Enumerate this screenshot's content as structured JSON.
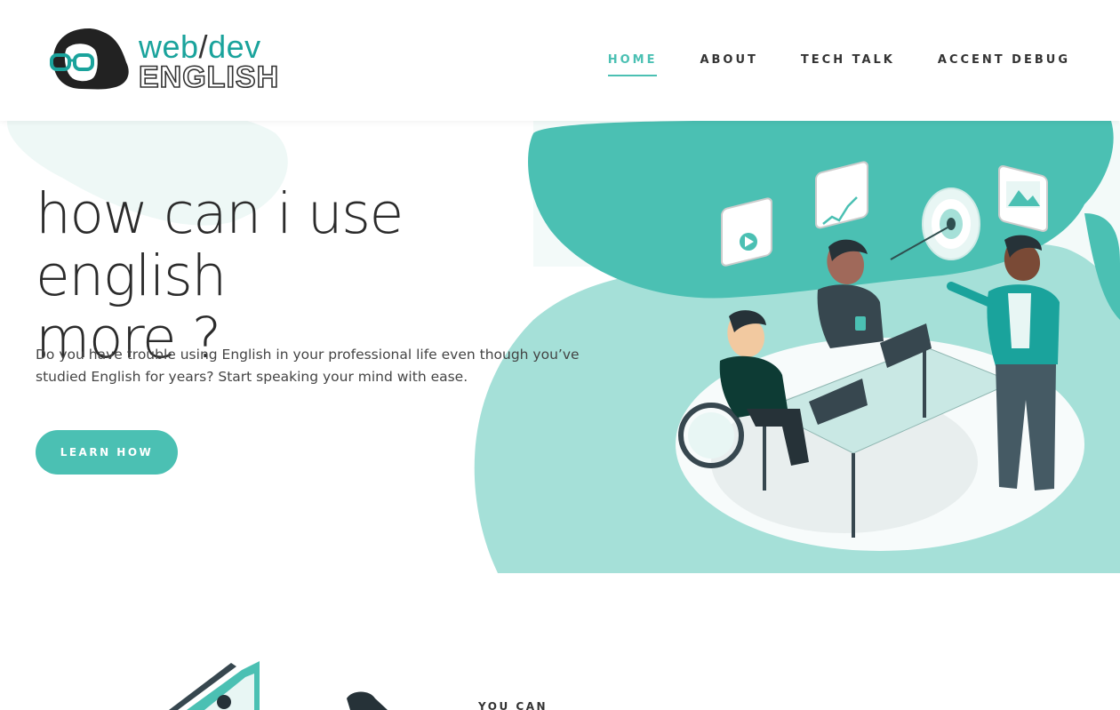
{
  "colors": {
    "accent": "#4bc0b3",
    "accent_dark": "#1aa39c",
    "blob_light": "#eef8f6",
    "blob_mid": "#a5e0d8",
    "text": "#2b2b2b"
  },
  "logo": {
    "top_left": "web",
    "slash": "/",
    "top_right": "dev",
    "bottom": "ENGLISH",
    "icon": "woman-with-glasses-logo"
  },
  "nav": {
    "items": [
      {
        "label": "HOME",
        "active": true
      },
      {
        "label": "ABOUT",
        "active": false
      },
      {
        "label": "TECH TALK",
        "active": false
      },
      {
        "label": "ACCENT DEBUG",
        "active": false
      }
    ]
  },
  "hero": {
    "title_line1": "how can i use english",
    "title_line2": "more  ?",
    "description": "Do you have trouble using English in your professional life even though you’ve studied English for years? Start speaking your mind with ease.",
    "cta_label": "LEARN HOW",
    "illustration": "team-meeting-illustration"
  },
  "section2": {
    "kicker": "YOU CAN",
    "illustration": "presentation-illustration"
  }
}
